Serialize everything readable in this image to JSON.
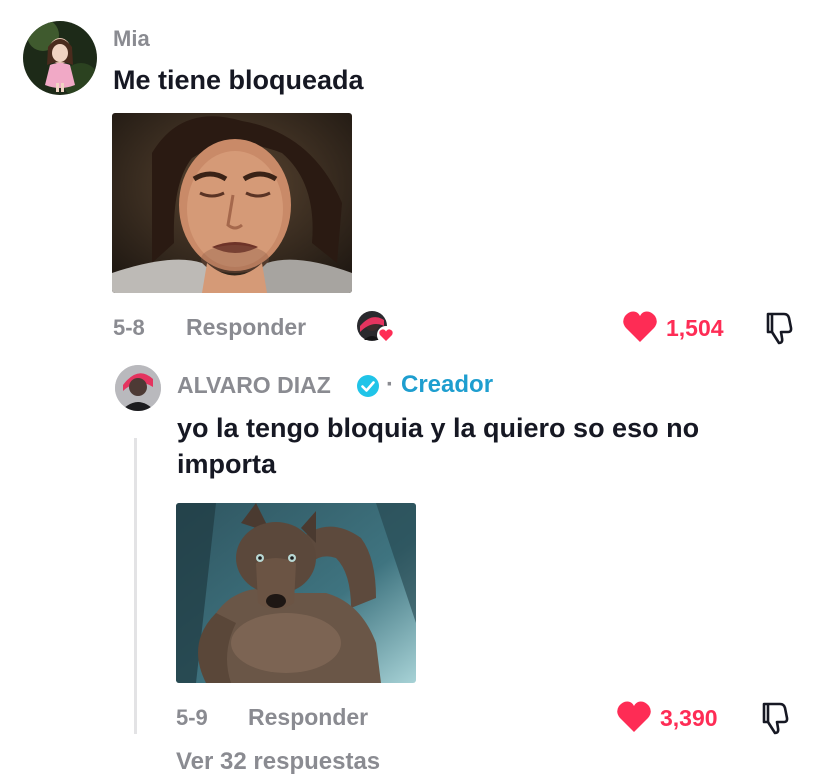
{
  "comment": {
    "username": "Mia",
    "text": "Me tiene bloqueada",
    "image_desc": "crying-man-gif",
    "date": "5-8",
    "reply_label": "Responder",
    "likes": "1,504"
  },
  "reply": {
    "username": "ALVARO DIAZ",
    "separator": "·",
    "badge": "Creador",
    "text": "yo la tengo bloquia y la quiero so eso no importa",
    "image_desc": "werewolf-meme",
    "date": "5-9",
    "reply_label": "Responder",
    "likes": "3,390"
  },
  "more_replies": "Ver 32 respuestas",
  "colors": {
    "like": "#fe2c55",
    "creator": "#1e9ecf",
    "muted": "#8a8b91"
  }
}
